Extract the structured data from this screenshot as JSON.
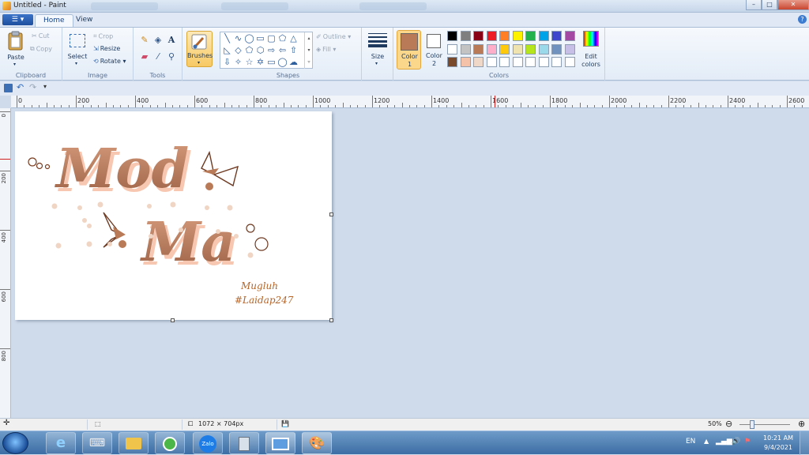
{
  "window": {
    "title": "Untitled - Paint",
    "min": "–",
    "max": "□",
    "close": "✕"
  },
  "menu": {
    "file_glyph": "☰ ▾",
    "tabs": [
      "Home",
      "View"
    ],
    "help": "?"
  },
  "ribbon": {
    "clipboard": {
      "paste": "Paste",
      "cut": "Cut",
      "copy": "Copy",
      "label": "Clipboard"
    },
    "image": {
      "select": "Select",
      "crop": "Crop",
      "resize": "Resize",
      "rotate": "Rotate",
      "label": "Image"
    },
    "tools": {
      "label": "Tools"
    },
    "brushes": {
      "label": "Brushes"
    },
    "shapes": {
      "label": "Shapes",
      "outline": "Outline",
      "fill": "Fill"
    },
    "size": {
      "label": "Size"
    },
    "colors": {
      "color1_label": "Color\n1",
      "color2_label": "Color\n2",
      "edit_colors": "Edit\ncolors",
      "label": "Colors",
      "color1_value": "#b97a57",
      "color2_value": "#ffffff",
      "palette_row1": [
        "#000000",
        "#7f7f7f",
        "#880015",
        "#ed1c24",
        "#ff7f27",
        "#fff200",
        "#22b14c",
        "#00a2e8",
        "#3f48cc",
        "#a349a4"
      ],
      "palette_row2": [
        "#ffffff",
        "#c3c3c3",
        "#b97a57",
        "#ffaec9",
        "#ffc90e",
        "#efe4b0",
        "#b5e61d",
        "#99d9ea",
        "#7092be",
        "#c8bfe7"
      ],
      "palette_row3": [
        "#7a4a2c",
        "#f4c2a8",
        "#f0d8c8",
        "#ffffff",
        "#ffffff",
        "#ffffff",
        "#ffffff",
        "#ffffff",
        "#ffffff",
        "#ffffff"
      ]
    }
  },
  "ruler": {
    "h_labels": [
      "0",
      "200",
      "400",
      "600",
      "800",
      "1000",
      "1200",
      "1400",
      "1600",
      "1800",
      "2000",
      "2200",
      "2400",
      "2600"
    ],
    "v_labels": [
      "0",
      "200",
      "400",
      "600",
      "800"
    ]
  },
  "canvas": {
    "line1": "Mod",
    "line2": "Ma",
    "sig1": "Mugluh",
    "sig2": "#Laidap247"
  },
  "status": {
    "dimensions": "1072 × 704px",
    "zoom": "50%"
  },
  "taskbar": {
    "lang": "EN",
    "time": "10:21 AM",
    "date": "9/4/2021",
    "zalo": "Zalo"
  }
}
